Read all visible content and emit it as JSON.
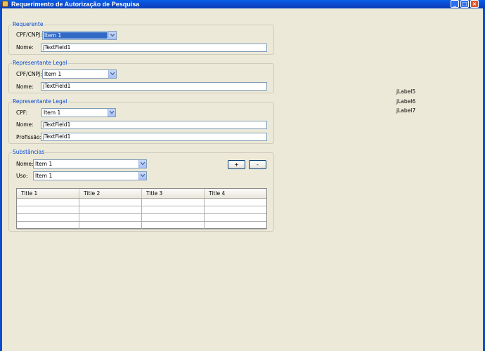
{
  "window": {
    "title": "Requerimento de Autorização de Pesquisa"
  },
  "requerente": {
    "title": "Requerente",
    "cpf_label": "CPF/CNPJ:",
    "cpf_value": "Item 1",
    "nome_label": "Nome:",
    "nome_value": "jTextField1"
  },
  "representante1": {
    "title": "Representante Legal",
    "cpf_label": "CPF/CNPJ:",
    "cpf_value": "Item 1",
    "nome_label": "Nome:",
    "nome_value": "jTextField1"
  },
  "representante2": {
    "title": "Representante Legal",
    "cpf_label": "CPF:",
    "cpf_value": "Item 1",
    "nome_label": "Nome:",
    "nome_value": "jTextField1",
    "profissao_label": "Profissão:",
    "profissao_value": "jTextField1"
  },
  "substancias": {
    "title": "Substâncias",
    "nome_label": "Nome:",
    "nome_value": "Item 1",
    "uso_label": "Uso:",
    "uso_value": "Item 1",
    "add_label": "+",
    "remove_label": "-",
    "columns": [
      "Title 1",
      "Title 2",
      "Title 3",
      "Title 4"
    ]
  },
  "side_labels": [
    "jLabel5",
    "jLabel6",
    "jLabel7"
  ],
  "colors": {
    "titlebar": "#0b4bd0",
    "group_title": "#0046d5",
    "selection": "#316ac5",
    "background": "#ece9d8"
  }
}
